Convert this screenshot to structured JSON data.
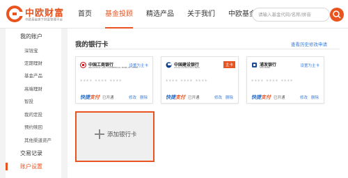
{
  "header": {
    "brand": "中欧财富",
    "brand_sub": "中欧基金旗下财富管理平台",
    "nav": [
      "首页",
      "基金投顾",
      "精选产品",
      "关于我们",
      "中欧基金"
    ],
    "active_nav_index": 1,
    "search": {
      "placeholder": "请输入基金代码/名称/拼音"
    },
    "accent_color": "#e8531f"
  },
  "sidebar": {
    "account_title": "我的账户",
    "items": [
      "深钱宝",
      "定期理财",
      "基金产品",
      "高端理财",
      "智投",
      "我的定投",
      "预约赎回",
      "其他渠道资产"
    ],
    "trade_records": "交易记录",
    "account_settings": "账户设置",
    "active": "账户设置"
  },
  "main": {
    "title": "我的银行卡",
    "history_link": "查看历史修改申请",
    "cards": [
      {
        "bank": "中国工商银行",
        "bank_en": "INDUSTRIAL AND COMMERCIAL BANK OF CHINA",
        "action": "设置为主卡",
        "is_main": false,
        "number": "**** **** ****",
        "fast_a": "快捷",
        "fast_b": "支付",
        "status": "已开通",
        "edit": "修改",
        "delete": "删除"
      },
      {
        "bank": "中国建设银行",
        "bank_en": "China Construction Bank",
        "action": "主卡",
        "is_main": true,
        "number": "**** **** ****",
        "fast_a": "快捷",
        "fast_b": "支付",
        "status": "已开通",
        "edit": "修改",
        "delete": "删除"
      },
      {
        "bank": "浦发银行",
        "bank_en": "SPD BANK",
        "action": "设置为主卡",
        "is_main": false,
        "number": "**** **** ****",
        "fast_a": "快捷",
        "fast_b": "支付",
        "status": "已开通",
        "edit": "修改",
        "delete": "删除"
      }
    ],
    "add_card": "添加银行卡"
  }
}
